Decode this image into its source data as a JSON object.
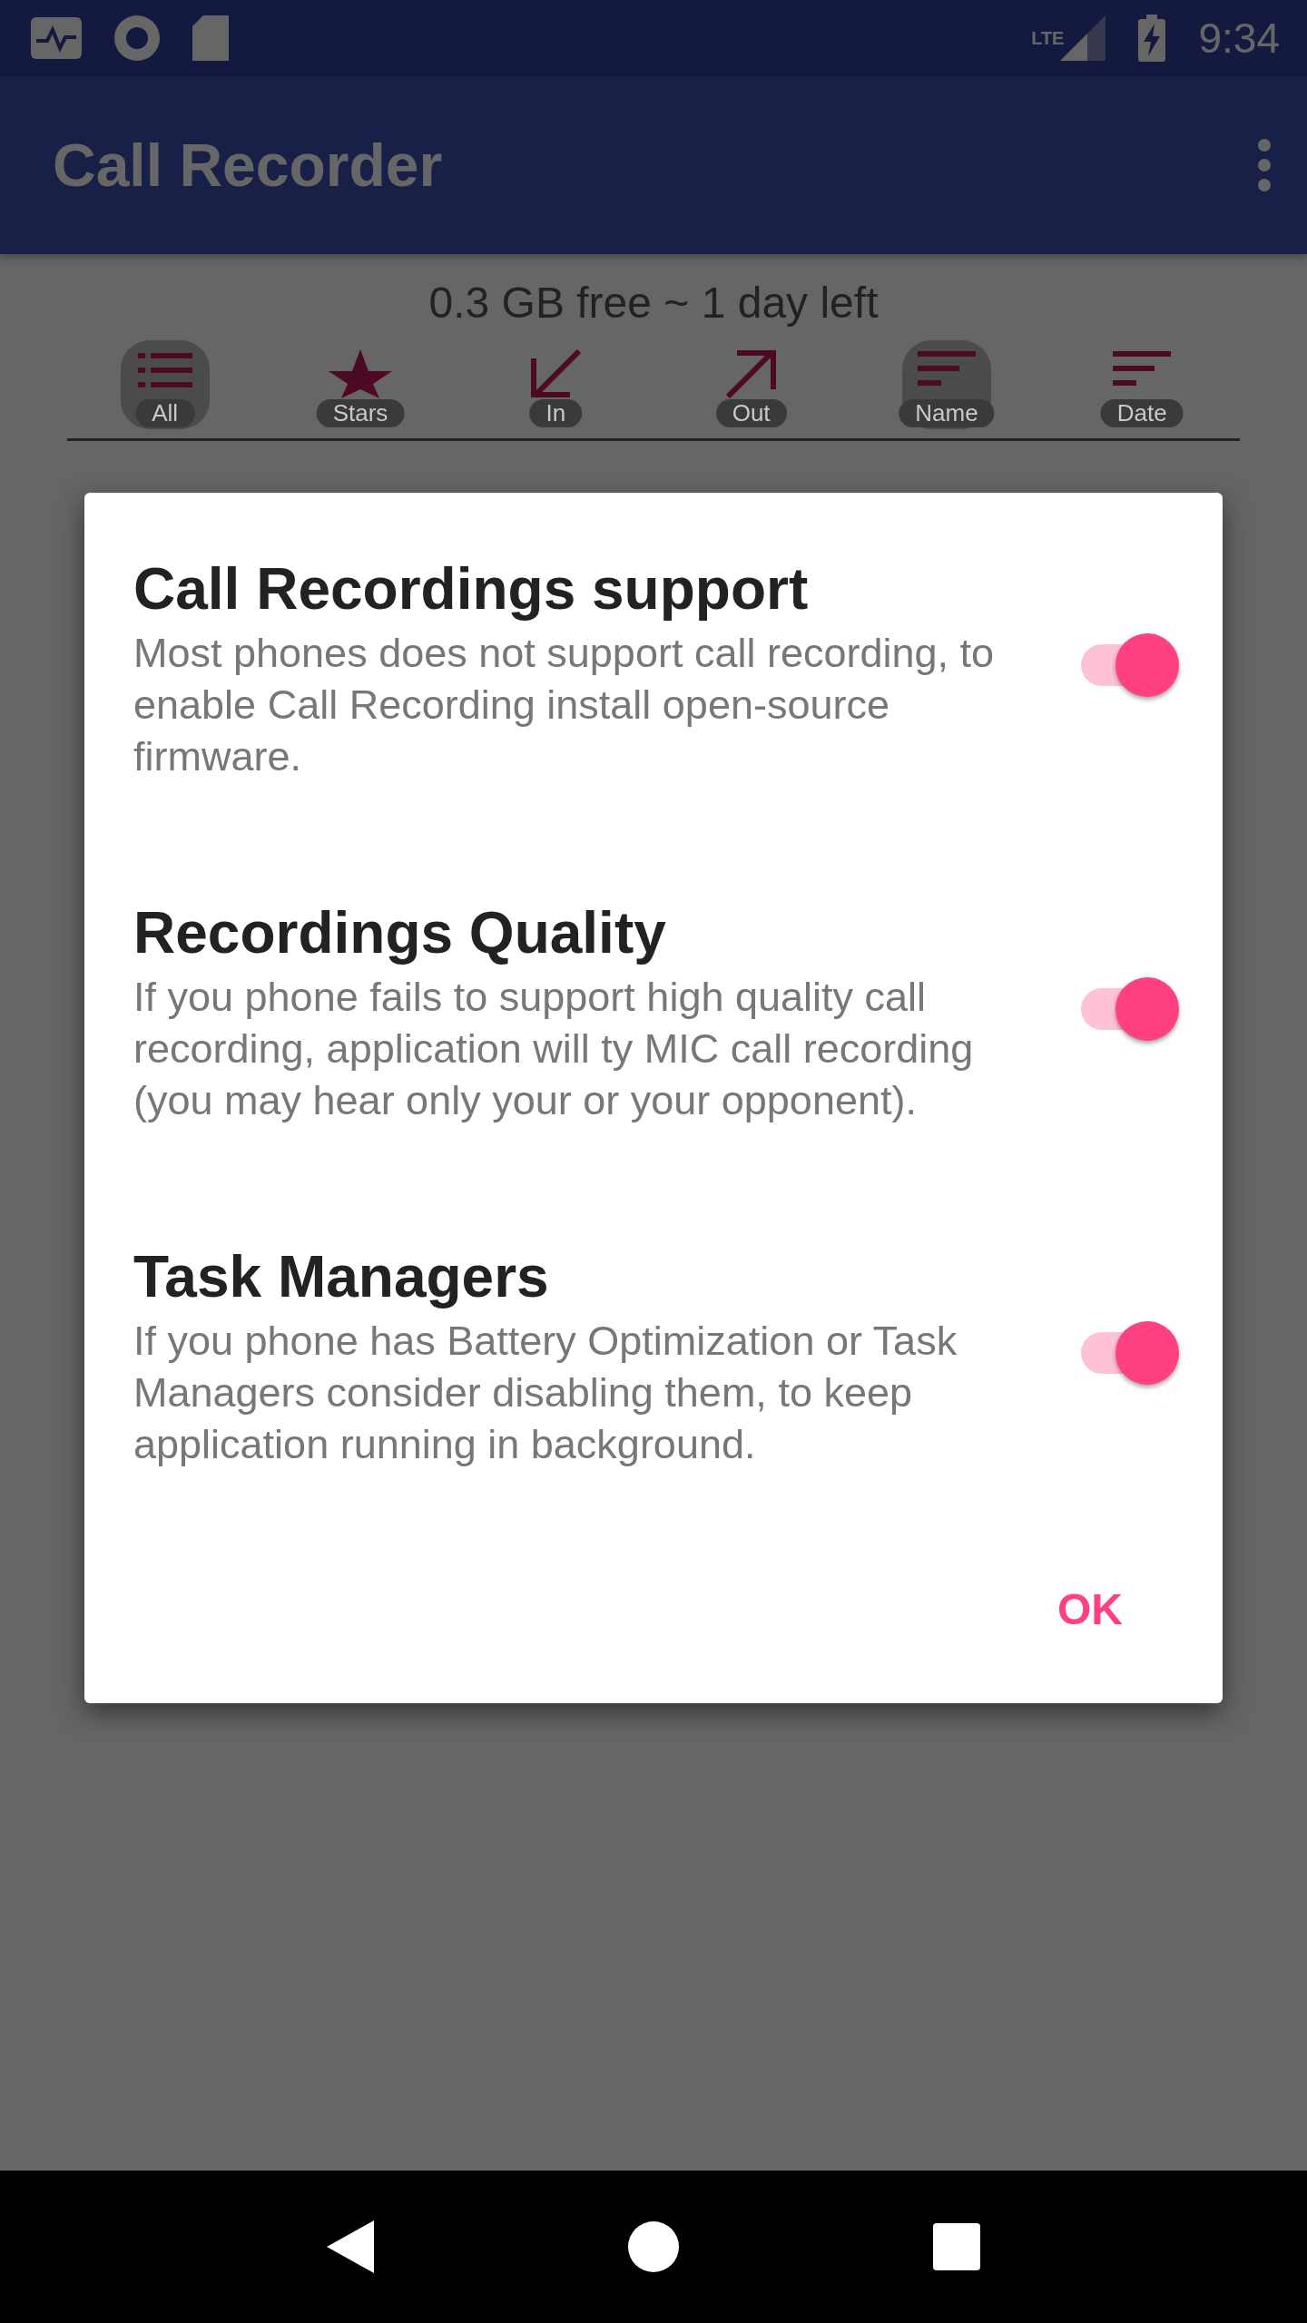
{
  "status_bar": {
    "time": "9:34",
    "network": "LTE"
  },
  "app_bar": {
    "title": "Call Recorder"
  },
  "storage": "0.3 GB free ~ 1 day left",
  "filters": [
    {
      "label": "All",
      "kind": "list",
      "selected": true
    },
    {
      "label": "Stars",
      "kind": "star",
      "selected": false
    },
    {
      "label": "In",
      "kind": "in",
      "selected": false
    },
    {
      "label": "Out",
      "kind": "out",
      "selected": false
    },
    {
      "label": "Name",
      "kind": "sort",
      "selected": true
    },
    {
      "label": "Date",
      "kind": "sort",
      "selected": false
    }
  ],
  "dialog": {
    "items": [
      {
        "title": "Call Recordings support",
        "text": "Most phones does not support call recording, to enable Call Recording install open-source firmware.",
        "on": true
      },
      {
        "title": "Recordings Quality",
        "text": "If you phone fails to support high quality call recording, application will ty MIC call recording (you may hear only your or your opponent).",
        "on": true
      },
      {
        "title": "Task Managers",
        "text": "If you phone has Battery Optimization or Task Managers consider disabling them, to keep application running in background.",
        "on": true
      }
    ],
    "button": "OK"
  }
}
